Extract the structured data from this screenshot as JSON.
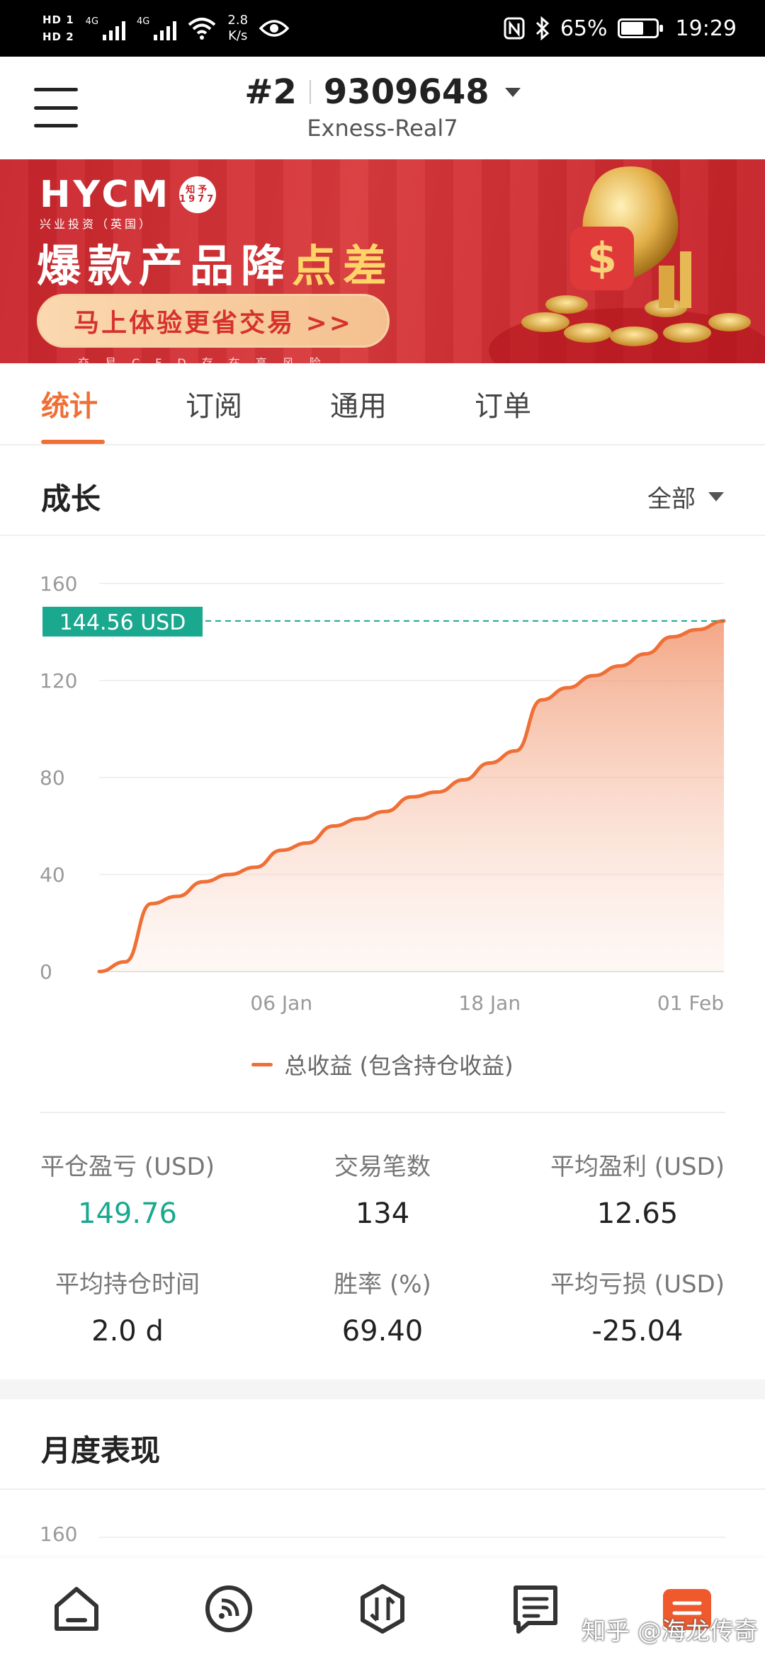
{
  "status_bar": {
    "sim1": "HD 1",
    "sim2": "HD 2",
    "net1": "4G",
    "net2": "4G",
    "speed_value": "2.8",
    "speed_unit": "K/s",
    "battery": "65%",
    "battery_level": 0.65,
    "time": "19:29"
  },
  "header": {
    "account_prefix": "#2",
    "account_number": "9309648",
    "server": "Exness-Real7"
  },
  "banner": {
    "brand": "HYCM",
    "seal_text": "知予 1977",
    "brand_sub": "兴业投资（英国）",
    "headline": "爆款产品降",
    "headline_highlight": "点差",
    "cta": "马上体验更省交易 >>",
    "risk_notice": "交易CFD存在高风险"
  },
  "tabs": [
    {
      "label": "统计",
      "active": true
    },
    {
      "label": "订阅",
      "active": false
    },
    {
      "label": "通用",
      "active": false
    },
    {
      "label": "订单",
      "active": false
    }
  ],
  "growth": {
    "title": "成长",
    "filter": "全部"
  },
  "chart_data": {
    "type": "area",
    "y_ticks": [
      "160",
      "120",
      "80",
      "40",
      "0"
    ],
    "ylim": [
      0,
      160
    ],
    "x_ticks": [
      "06 Jan",
      "18 Jan",
      "01 Feb"
    ],
    "current_value_label": "144.56 USD",
    "current_value": 144.56,
    "series": [
      {
        "name": "总收益 (包含持仓收益)",
        "color": "#ef6f36",
        "values": [
          0,
          4,
          28,
          31,
          37,
          40,
          43,
          50,
          53,
          60,
          63,
          66,
          72,
          74,
          79,
          86,
          91,
          112,
          117,
          122,
          126,
          131,
          138,
          141,
          144.56
        ]
      }
    ],
    "grid": true
  },
  "stats": {
    "closed_pnl_label": "平仓盈亏 (USD)",
    "closed_pnl_value": "149.76",
    "trades_label": "交易笔数",
    "trades_value": "134",
    "avg_profit_label": "平均盈利 (USD)",
    "avg_profit_value": "12.65",
    "avg_hold_label": "平均持仓时间",
    "avg_hold_value": "2.0 d",
    "win_rate_label": "胜率 (%)",
    "win_rate_value": "69.40",
    "avg_loss_label": "平均亏损 (USD)",
    "avg_loss_value": "-25.04"
  },
  "monthly": {
    "title": "月度表现",
    "first_tick": "160"
  },
  "bottom_nav": [
    "home-icon",
    "signals-icon",
    "trade-icon",
    "orders-icon",
    "fx-icon"
  ],
  "watermark": "知乎 @海龙传奇"
}
